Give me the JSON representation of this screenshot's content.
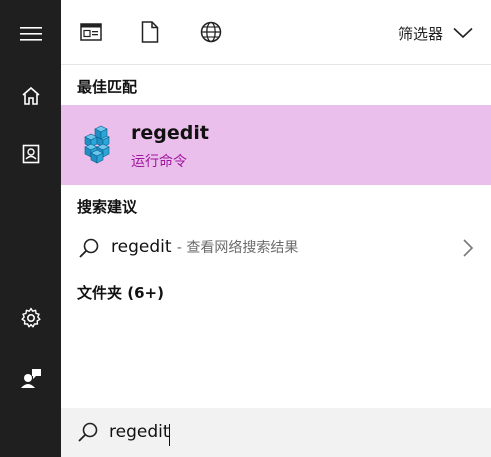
{
  "toolbar": {
    "filter_label": "筛选器",
    "icons": [
      "apps-icon",
      "document-icon",
      "globe-icon"
    ]
  },
  "sections": {
    "best_match_title": "最佳匹配",
    "suggestions_title": "搜索建议",
    "folders_title": "文件夹 (6+)"
  },
  "best_match": {
    "name": "regedit",
    "subtitle": "运行命令"
  },
  "suggestion": {
    "query": "regedit",
    "hint": "- 查看网络搜索结果"
  },
  "search": {
    "value": "regedit"
  },
  "colors": {
    "rail": "#1f1f1f",
    "highlight": "#ebbfeb",
    "accent_text": "#a0179f",
    "searchbar": "#f2f2f2"
  }
}
